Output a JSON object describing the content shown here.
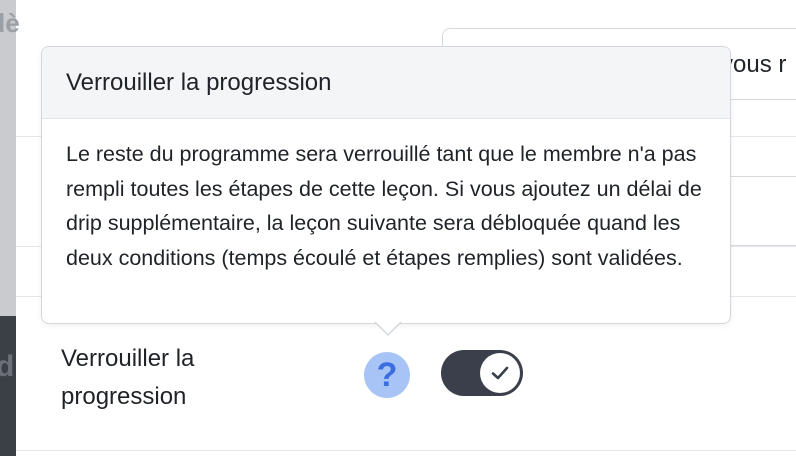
{
  "background": {
    "card_partial_text": "vous r",
    "sidebar_fragment_top": "lè",
    "sidebar_fragment_bottom": "d"
  },
  "tooltip": {
    "title": "Verrouiller la progression",
    "body": "Le reste du programme sera verrouillé tant que le membre n'a pas rempli toutes les étapes de cette leçon. Si vous ajoutez un délai de drip supplémentaire, la leçon suivante sera débloquée quand les deux conditions (temps écoulé et étapes remplies) sont validées."
  },
  "setting": {
    "label": "Verrouiller la progression",
    "help_symbol": "?",
    "toggle_on": true,
    "toggle_icon": "check-icon"
  },
  "colors": {
    "toggle_track": "#3a3f4b",
    "help_icon_bg": "#a8c4f7",
    "help_icon_fg": "#3b6fe0"
  }
}
